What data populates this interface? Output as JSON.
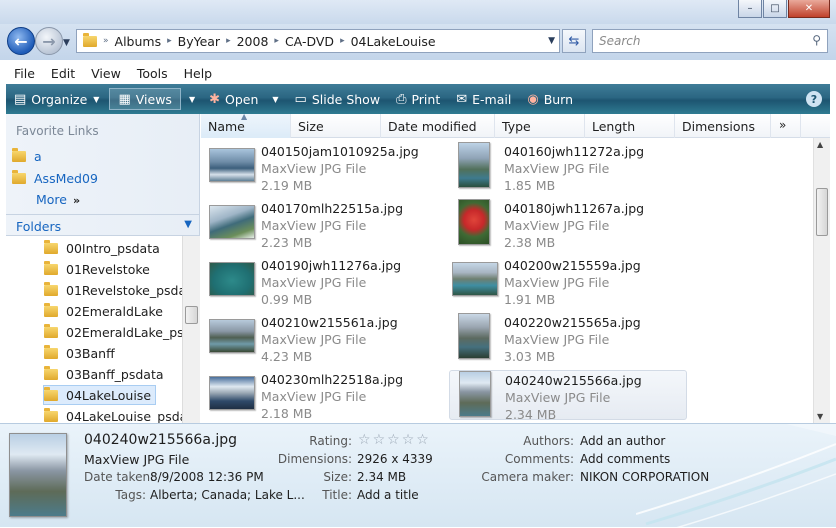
{
  "window": {
    "buttons": {
      "minimize": "–",
      "maximize": "□",
      "close": "✕"
    }
  },
  "nav": {
    "breadcrumbs": [
      "Albums",
      "ByYear",
      "2008",
      "CA-DVD",
      "04LakeLouise"
    ],
    "search_placeholder": "Search"
  },
  "menu": [
    "File",
    "Edit",
    "View",
    "Tools",
    "Help"
  ],
  "toolbar": {
    "organize": "Organize",
    "views": "Views",
    "open": "Open",
    "slideshow": "Slide Show",
    "print": "Print",
    "email": "E-mail",
    "burn": "Burn"
  },
  "sidebar": {
    "favorites_header": "Favorite Links",
    "favorites": [
      "a",
      "AssMed09"
    ],
    "more": "More",
    "folders_header": "Folders",
    "tree": [
      "00Intro_psdata",
      "01Revelstoke",
      "01Revelstoke_psdat",
      "02EmeraldLake",
      "02EmeraldLake_psd",
      "03Banff",
      "03Banff_psdata",
      "04LakeLouise",
      "04LakeLouise_psdat"
    ],
    "selected": "04LakeLouise"
  },
  "columns": [
    "Name",
    "Size",
    "Date modified",
    "Type",
    "Length",
    "Dimensions"
  ],
  "files": [
    {
      "name": "040150jam1010925a.jpg",
      "type": "MaxView JPG File",
      "size": "2.19 MB"
    },
    {
      "name": "040160jwh11272a.jpg",
      "type": "MaxView JPG File",
      "size": "1.85 MB"
    },
    {
      "name": "040170mlh22515a.jpg",
      "type": "MaxView JPG File",
      "size": "2.23 MB"
    },
    {
      "name": "040180jwh11267a.jpg",
      "type": "MaxView JPG File",
      "size": "2.38 MB"
    },
    {
      "name": "040190jwh11276a.jpg",
      "type": "MaxView JPG File",
      "size": "0.99 MB"
    },
    {
      "name": "040200w215559a.jpg",
      "type": "MaxView JPG File",
      "size": "1.91 MB"
    },
    {
      "name": "040210w215561a.jpg",
      "type": "MaxView JPG File",
      "size": "4.23 MB"
    },
    {
      "name": "040220w215565a.jpg",
      "type": "MaxView JPG File",
      "size": "3.03 MB"
    },
    {
      "name": "040230mlh22518a.jpg",
      "type": "MaxView JPG File",
      "size": "2.18 MB"
    },
    {
      "name": "040240w215566a.jpg",
      "type": "MaxView JPG File",
      "size": "2.34 MB"
    }
  ],
  "details": {
    "name": "040240w215566a.jpg",
    "type": "MaxView JPG File",
    "date_taken_label": "Date taken:",
    "date_taken": "8/9/2008 12:36 PM",
    "tags_label": "Tags:",
    "tags": "Alberta; Canada; Lake L...",
    "rating_label": "Rating:",
    "rating": 0,
    "dimensions_label": "Dimensions:",
    "dimensions": "2926 x 4339",
    "size_label": "Size:",
    "size": "2.34 MB",
    "title_label": "Title:",
    "title": "Add a title",
    "authors_label": "Authors:",
    "authors": "Add an author",
    "comments_label": "Comments:",
    "comments": "Add comments",
    "camera_label": "Camera maker:",
    "camera": "NIKON CORPORATION"
  }
}
